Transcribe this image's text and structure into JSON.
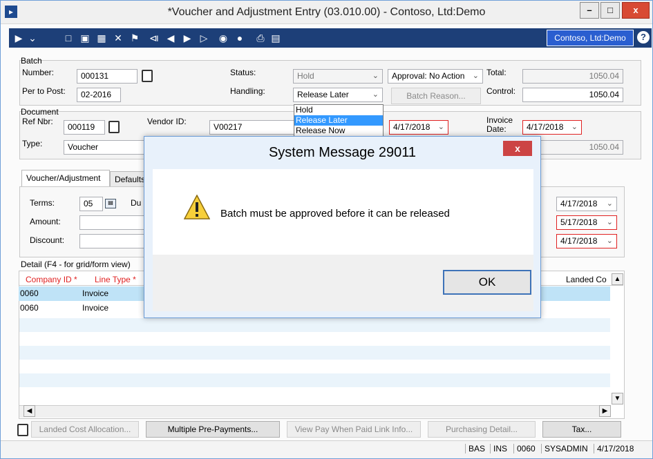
{
  "window": {
    "title": "*Voucher and Adjustment Entry (03.010.00) - Contoso, Ltd:Demo",
    "minimize": "–",
    "maximize": "□",
    "close": "x"
  },
  "toolbar": {
    "company": "Contoso, Ltd:Demo",
    "help": "?"
  },
  "batch": {
    "group_label": "Batch",
    "number_label": "Number:",
    "number_value": "000131",
    "per_to_post_label": "Per to Post:",
    "per_to_post_value": "02-2016",
    "status_label": "Status:",
    "status_value": "Hold",
    "handling_label": "Handling:",
    "handling_value": "Release Later",
    "approval_value": "Approval: No Action",
    "batch_reason_button": "Batch Reason...",
    "total_label": "Total:",
    "total_value": "1050.04",
    "control_label": "Control:",
    "control_value": "1050.04"
  },
  "handling_dropdown": {
    "options": [
      "Hold",
      "Release Later",
      "Release Now"
    ]
  },
  "document": {
    "group_label": "Document",
    "ref_nbr_label": "Ref Nbr:",
    "ref_nbr_value": "000119",
    "vendor_id_label": "Vendor ID:",
    "vendor_id_value": "V00217",
    "doc_date_value": "4/17/2018",
    "invoice_date_label": "Invoice Date:",
    "invoice_date_value": "4/17/2018",
    "type_label": "Type:",
    "type_value": "Voucher",
    "right_amount": "1050.04"
  },
  "tabs": {
    "voucher": "Voucher/Adjustment",
    "defaults": "Defaults"
  },
  "voucher_tab": {
    "terms_label": "Terms:",
    "terms_value": "05",
    "due_label": "Du",
    "amount_label": "Amount:",
    "discount_label": "Discount:",
    "date1": "4/17/2018",
    "date2": "5/17/2018",
    "date3": "4/17/2018"
  },
  "detail": {
    "label": "Detail  (F4 - for grid/form view)",
    "col_company": "Company ID *",
    "col_line_type": "Line Type *",
    "col_landed": "Landed Co",
    "rows": [
      {
        "company": "0060",
        "line_type": "Invoice"
      },
      {
        "company": "0060",
        "line_type": "Invoice"
      }
    ]
  },
  "bottom_buttons": {
    "landed_cost": "Landed Cost Allocation...",
    "multiple_prepay": "Multiple Pre-Payments...",
    "view_pay": "View Pay When Paid Link Info...",
    "purchasing": "Purchasing Detail...",
    "tax": "Tax..."
  },
  "statusbar": {
    "s1": "BAS",
    "s2": "INS",
    "s3": "0060",
    "s4": "SYSADMIN",
    "s5": "4/17/2018"
  },
  "dialog": {
    "title": "System Message 29011",
    "message": "Batch must be approved before it can be released",
    "ok": "OK",
    "close": "x"
  },
  "colors": {
    "toolbar": "#1d3f78",
    "company_button": "#2a5ed0",
    "selection": "#3399ff",
    "required_red": "#e02020",
    "grid_highlight": "#bfe3f7"
  }
}
